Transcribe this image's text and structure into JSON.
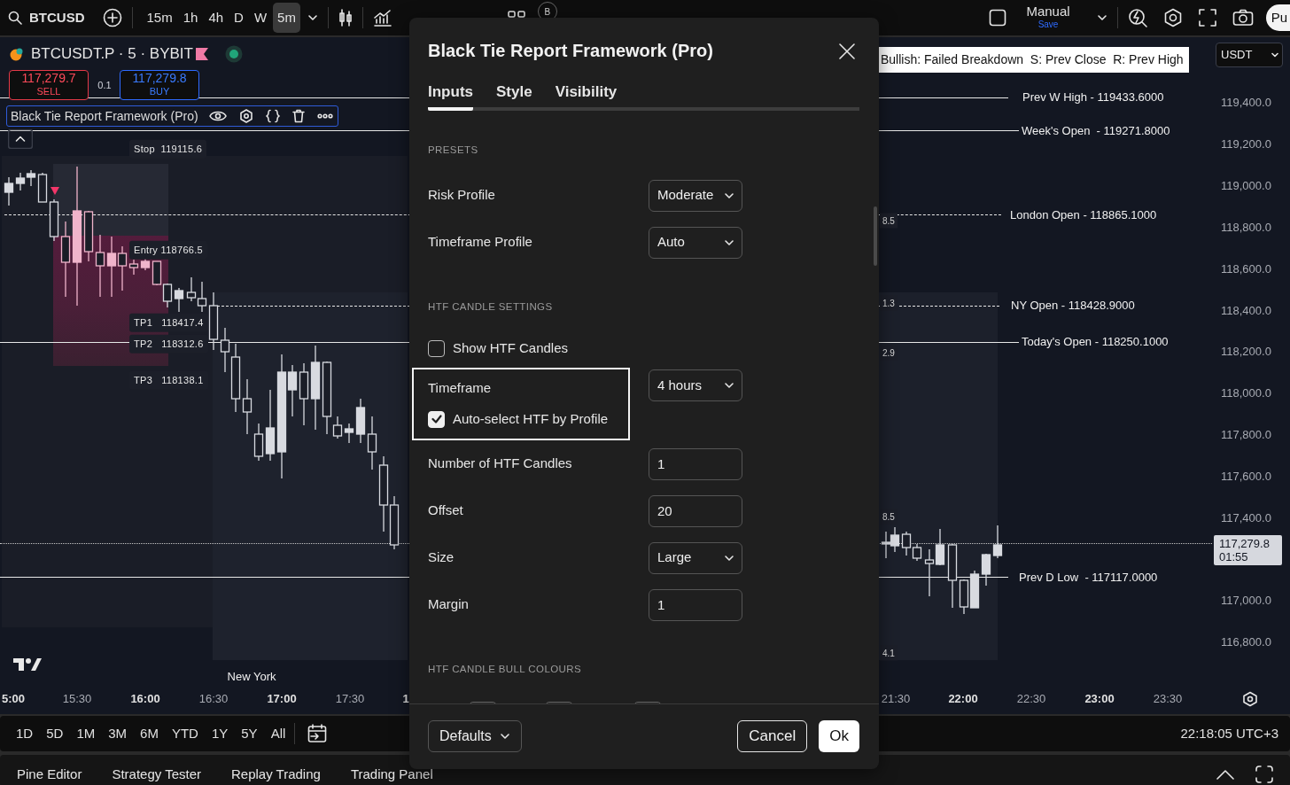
{
  "toolbar": {
    "symbol": "BTCUSD",
    "intervals": [
      {
        "label": "15m",
        "selected": false
      },
      {
        "label": "1h",
        "selected": false
      },
      {
        "label": "4h",
        "selected": false
      },
      {
        "label": "D",
        "selected": false
      },
      {
        "label": "W",
        "selected": false
      },
      {
        "label": "5m",
        "selected": true
      }
    ],
    "account": "B",
    "layout_name": "Manual",
    "layout_status": "Save",
    "publish": "Pu"
  },
  "legend": {
    "pair": "BTCUSDT.P · 5 · BYBIT",
    "sell_price": "117,279.7",
    "sell": "SELL",
    "spread": "0.1",
    "buy_price": "117,279.8",
    "buy": "BUY",
    "indicator": "Black Tie Report Framework (Pro)"
  },
  "chart": {
    "trade_labels": [
      "Stop  119115.6",
      "Entry 118766.5",
      "TP1   118417.4",
      "TP2   118312.6",
      "TP3   118138.1"
    ],
    "signal_banner": "Bullish: Failed Breakdown  S: Prev Close  R: Prev High",
    "level_labels": [
      "Prev W High - 119433.6000",
      "Week's Open  - 119271.8000",
      "London Open - 118865.1000",
      "NY Open - 118428.9000",
      "Today's Open - 118250.1000",
      "Prev D Low  - 117117.0000"
    ],
    "edge_labels": [
      "8.5",
      "1.3",
      "2.9",
      "8.5",
      "4.1"
    ],
    "session_label": "New York",
    "currency": "USDT",
    "price_axis": [
      "119,400.0",
      "119,200.0",
      "119,000.0",
      "118,800.0",
      "118,600.0",
      "118,400.0",
      "118,200.0",
      "118,000.0",
      "117,800.0",
      "117,600.0",
      "117,400.0",
      "117,000.0",
      "116,800.0"
    ],
    "last_price": {
      "price": "117,279.8",
      "countdown": "01:55"
    },
    "time_axis": [
      {
        "label": "5:00",
        "major": true
      },
      {
        "label": "15:30",
        "major": false
      },
      {
        "label": "16:00",
        "major": true
      },
      {
        "label": "16:30",
        "major": false
      },
      {
        "label": "17:00",
        "major": true
      },
      {
        "label": "17:30",
        "major": false
      },
      {
        "label": "1",
        "major": true
      },
      {
        "label": "21:30",
        "major": false
      },
      {
        "label": "22:00",
        "major": true
      },
      {
        "label": "22:30",
        "major": false
      },
      {
        "label": "23:00",
        "major": true
      },
      {
        "label": "23:30",
        "major": false
      }
    ]
  },
  "ranges": [
    "1D",
    "5D",
    "1M",
    "3M",
    "6M",
    "YTD",
    "1Y",
    "5Y",
    "All"
  ],
  "clock": "22:18:05 UTC+3",
  "bottom_tabs": [
    "Pine Editor",
    "Strategy Tester",
    "Replay Trading",
    "Trading Panel"
  ],
  "modal": {
    "title": "Black Tie Report Framework (Pro)",
    "tabs": [
      {
        "label": "Inputs",
        "selected": true
      },
      {
        "label": "Style",
        "selected": false
      },
      {
        "label": "Visibility",
        "selected": false
      }
    ],
    "sections": [
      {
        "title": "PRESETS",
        "rows": [
          {
            "kind": "select",
            "label": "Risk Profile",
            "value": "Moderate",
            "highlighted": false
          },
          {
            "kind": "select",
            "label": "Timeframe Profile",
            "value": "Auto",
            "highlighted": false
          }
        ]
      },
      {
        "title": "HTF CANDLE SETTINGS",
        "rows": [
          {
            "kind": "checkbox",
            "label": "Show HTF Candles",
            "checked": false,
            "highlighted": false
          },
          {
            "kind": "select",
            "label": "Timeframe",
            "value": "4 hours",
            "highlighted": true
          },
          {
            "kind": "checkbox",
            "label": "Auto-select HTF by Profile",
            "checked": true,
            "highlighted": true
          },
          {
            "kind": "input",
            "label": "Number of HTF Candles",
            "value": "1",
            "highlighted": false
          },
          {
            "kind": "input",
            "label": "Offset",
            "value": "20",
            "highlighted": false
          },
          {
            "kind": "select",
            "label": "Size",
            "value": "Large",
            "highlighted": false
          },
          {
            "kind": "input",
            "label": "Margin",
            "value": "1",
            "highlighted": false
          }
        ]
      },
      {
        "title": "HTF CANDLE BULL COLOURS",
        "rows": [
          {
            "kind": "swatches",
            "swatches": [
              {
                "kind": "swatch"
              },
              {
                "kind": "swatch"
              },
              {
                "kind": "swatch"
              }
            ]
          }
        ]
      }
    ],
    "defaults": "Defaults",
    "cancel": "Cancel",
    "ok": "Ok"
  }
}
